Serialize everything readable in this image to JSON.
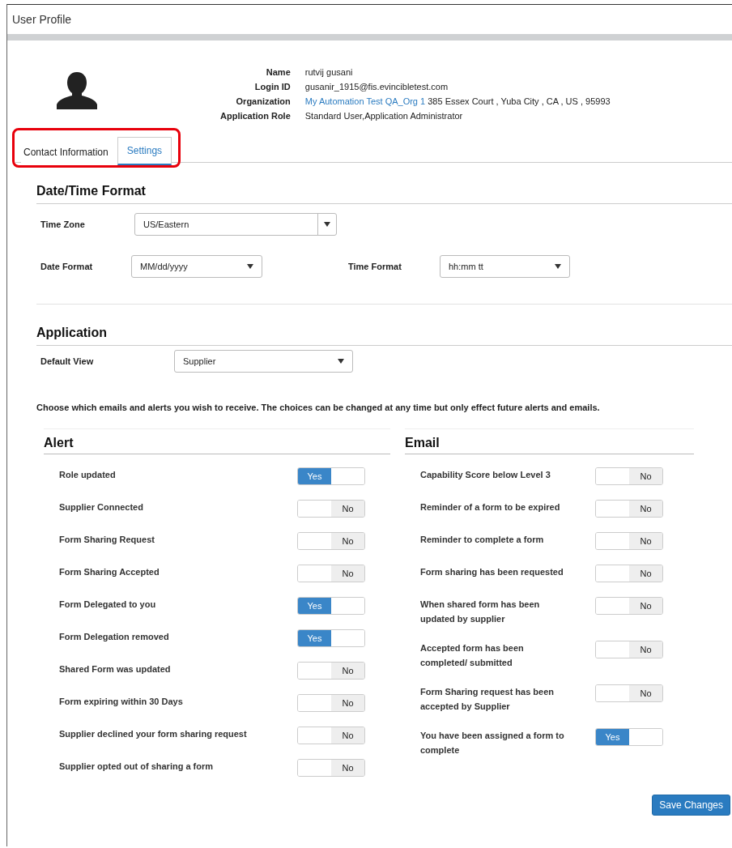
{
  "window": {
    "title": "User Profile"
  },
  "profile": {
    "fields": [
      {
        "label": "Name",
        "value": "rutvij gusani"
      },
      {
        "label": "Login ID",
        "value": "gusanir_1915@fis.evincibletest.com"
      },
      {
        "label": "Organization",
        "link": "My Automation Test QA_Org 1",
        "value": "385 Essex Court , Yuba City , CA , US , 95993"
      },
      {
        "label": "Application Role",
        "value": "Standard User,Application Administrator"
      }
    ]
  },
  "tabs_highlighted": true,
  "tabs": [
    {
      "label": "Contact Information",
      "selected": false
    },
    {
      "label": "Settings",
      "selected": true
    }
  ],
  "date_time_format": {
    "title": "Date/Time Format",
    "time_zone": {
      "label": "Time Zone",
      "value": "US/Eastern"
    },
    "date_format": {
      "label": "Date Format",
      "value": "MM/dd/yyyy"
    },
    "time_format": {
      "label": "Time Format",
      "value": "hh:mm tt"
    }
  },
  "application": {
    "title": "Application",
    "default_view": {
      "label": "Default View",
      "value": "Supplier"
    }
  },
  "notice": "Choose which emails and alerts you wish to receive. The choices can be changed at any time but only effect future alerts and emails.",
  "alert": {
    "title": "Alert",
    "items": [
      {
        "label": "Role updated",
        "on": true,
        "value": "Yes"
      },
      {
        "label": "Supplier Connected",
        "on": false,
        "value": "No"
      },
      {
        "label": "Form Sharing Request",
        "on": false,
        "value": "No"
      },
      {
        "label": "Form Sharing Accepted",
        "on": false,
        "value": "No"
      },
      {
        "label": "Form Delegated to you",
        "on": true,
        "value": "Yes"
      },
      {
        "label": "Form Delegation removed",
        "on": true,
        "value": "Yes"
      },
      {
        "label": "Shared Form was updated",
        "on": false,
        "value": "No"
      },
      {
        "label": "Form expiring within 30 Days",
        "on": false,
        "value": "No"
      },
      {
        "label": "Supplier declined your form sharing request",
        "on": false,
        "value": "No"
      },
      {
        "label": "Supplier opted out of sharing a form",
        "on": false,
        "value": "No"
      }
    ]
  },
  "email": {
    "title": "Email",
    "items": [
      {
        "label": "Capability Score below Level 3",
        "on": false,
        "value": "No"
      },
      {
        "label": "Reminder of a form to be expired",
        "on": false,
        "value": "No"
      },
      {
        "label": "Reminder to complete a form",
        "on": false,
        "value": "No"
      },
      {
        "label": "Form sharing has been requested",
        "on": false,
        "value": "No"
      },
      {
        "label": "When shared form has been updated by supplier",
        "on": false,
        "value": "No"
      },
      {
        "label": "Accepted form has been completed/ submitted",
        "on": false,
        "value": "No"
      },
      {
        "label": "Form Sharing request has been accepted by Supplier",
        "on": false,
        "value": "No"
      },
      {
        "label": "You have been assigned a form to complete",
        "on": true,
        "value": "Yes"
      }
    ]
  },
  "save_button": "Save Changes"
}
